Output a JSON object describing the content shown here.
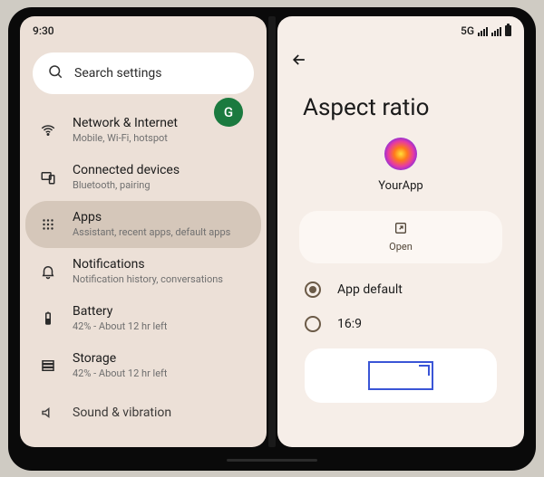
{
  "status": {
    "time": "9:30",
    "network": "5G"
  },
  "search": {
    "placeholder": "Search settings",
    "avatar_letter": "G"
  },
  "menu": {
    "items": [
      {
        "title": "Network & Internet",
        "sub": "Mobile, Wi-Fi, hotspot"
      },
      {
        "title": "Connected devices",
        "sub": "Bluetooth, pairing"
      },
      {
        "title": "Apps",
        "sub": "Assistant, recent apps, default apps"
      },
      {
        "title": "Notifications",
        "sub": "Notification history, conversations"
      },
      {
        "title": "Battery",
        "sub": "42% - About 12 hr left"
      },
      {
        "title": "Storage",
        "sub": "42% - About 12 hr left"
      },
      {
        "title": "Sound & vibration",
        "sub": ""
      }
    ],
    "selected_index": 2
  },
  "detail": {
    "title": "Aspect ratio",
    "app_name": "YourApp",
    "open_label": "Open",
    "options": [
      {
        "label": "App default",
        "checked": true
      },
      {
        "label": "16:9",
        "checked": false
      }
    ]
  }
}
